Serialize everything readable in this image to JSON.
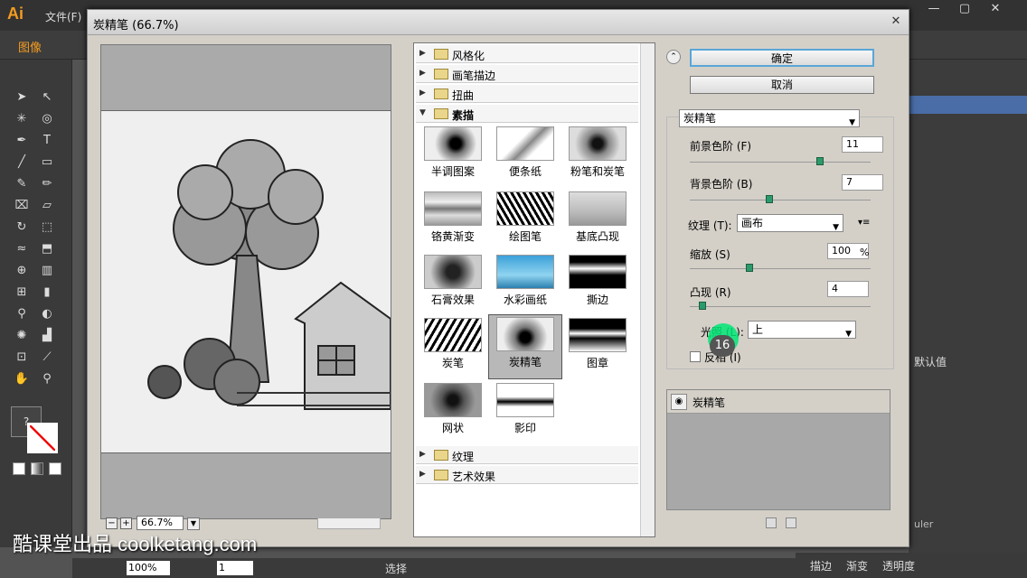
{
  "app": {
    "logo": "Ai",
    "menu_file": "文件(F)",
    "doc_label": "图像",
    "zoom": "100%",
    "status_text": "选择",
    "page": "1"
  },
  "watermark": "酷课堂出品 coolketang.com",
  "window_controls": {
    "minimize": "—",
    "restore": "▢",
    "close": "✕"
  },
  "right_panels": {
    "text1": "默认值",
    "tab1": "描边",
    "tab2": "渐变",
    "tab3": "透明度",
    "ruler": "uler"
  },
  "dialog": {
    "title": "炭精笔 (66.7%)",
    "close": "✕",
    "zoom_minus": "−",
    "zoom_plus": "+",
    "zoom_value": "66.7%",
    "categories_top": [
      {
        "label": "风格化",
        "expanded": false
      },
      {
        "label": "画笔描边",
        "expanded": false
      },
      {
        "label": "扭曲",
        "expanded": false
      },
      {
        "label": "素描",
        "expanded": true
      }
    ],
    "thumbnails": [
      {
        "label": "半调图案"
      },
      {
        "label": "便条纸"
      },
      {
        "label": "粉笔和炭笔"
      },
      {
        "label": "铬黄渐变"
      },
      {
        "label": "绘图笔"
      },
      {
        "label": "基底凸现"
      },
      {
        "label": "石膏效果"
      },
      {
        "label": "水彩画纸"
      },
      {
        "label": "撕边"
      },
      {
        "label": "炭笔"
      },
      {
        "label": "炭精笔",
        "selected": true
      },
      {
        "label": "图章"
      },
      {
        "label": "网状"
      },
      {
        "label": "影印"
      }
    ],
    "categories_bottom": [
      {
        "label": "纹理",
        "expanded": false
      },
      {
        "label": "艺术效果",
        "expanded": false
      }
    ],
    "ok": "确定",
    "cancel": "取消",
    "filter_select": "炭精笔",
    "fg_label": "前景色阶 (F)",
    "fg_value": "11",
    "fg_level": 0.72,
    "bg_label": "背景色阶 (B)",
    "bg_value": "7",
    "bg_level": 0.44,
    "texture_label": "纹理 (T):",
    "texture_value": "画布",
    "scale_label": "缩放 (S)",
    "scale_value": "100",
    "scale_unit": "%",
    "relief_label": "凸现 (R)",
    "relief_value": "4",
    "light_label": "光照 (L):",
    "light_value": "上",
    "invert_label": "反相 (I)",
    "layer_name": "炭精笔",
    "badge": "16"
  }
}
